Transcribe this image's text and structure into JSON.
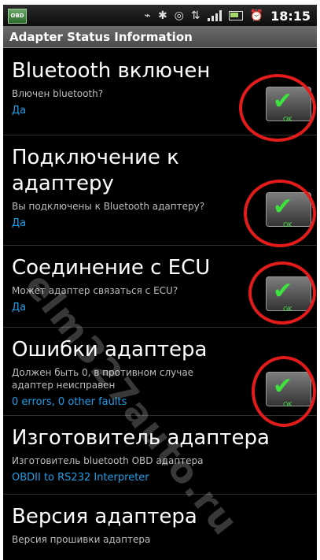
{
  "status_bar": {
    "app_icon_label": "OBD",
    "icons": [
      "usb-icon",
      "bluetooth-icon",
      "sync-icon",
      "network-icon",
      "signal-icon",
      "battery-icon",
      "alarm-icon"
    ],
    "time": "18:15"
  },
  "title_bar": {
    "title": "Adapter Status Information"
  },
  "items": [
    {
      "title": "Bluetooth включен",
      "description": "Влючен bluetooth?",
      "value": "Да",
      "ok_label": "OK"
    },
    {
      "title": "Подключение к адаптеру",
      "description": "Вы подключены к Bluetooth адаптеру?",
      "value": "Да",
      "ok_label": "OK"
    },
    {
      "title": "Соединение с ECU",
      "description": "Может адаптер связаться с ECU?",
      "value": "Да",
      "ok_label": "OK"
    },
    {
      "title": "Ошибки адаптера",
      "description": "Должен быть 0, в противном случае адаптер неисправен",
      "value": "0 errors, 0 other faults",
      "ok_label": "OK"
    },
    {
      "title": "Изготовитель адаптера",
      "description": "Изготовитель bluetooth OBD адаптера",
      "value": "OBDII to RS232 Interpreter"
    },
    {
      "title": "Версия адаптера",
      "description": "Версия прошивки адаптера"
    }
  ],
  "watermark": "elm327auto.ru",
  "colors": {
    "value_blue": "#1f9ee8",
    "check_green": "#3de23d",
    "ring_red": "#e31b1b",
    "title_bar": "#5a5a5a"
  }
}
